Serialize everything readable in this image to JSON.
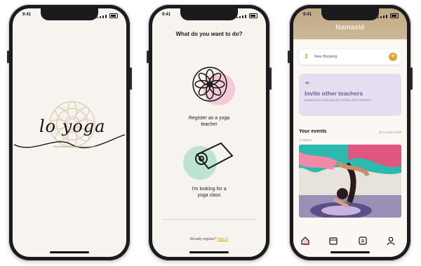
{
  "screens": [
    {
      "status_time": "9:41",
      "logo_text": "lo yoga"
    },
    {
      "status_time": "9:41",
      "question": "What do you want to do?",
      "option_teacher": [
        "Register as a yoga",
        "teacher"
      ],
      "option_class": [
        "I'm looking for a",
        "yoga class"
      ],
      "footer_text": "Already register?",
      "footer_link": "Sign in"
    },
    {
      "status_time": "9:41",
      "header_title": "Namasté",
      "booking": {
        "count": "3",
        "label": "New Booking",
        "plus": "+"
      },
      "invite": {
        "title": "Invite other teachers",
        "body": "Expand your earnings by inviting other teachers"
      },
      "events": {
        "title": "Your events",
        "date": "30 october 2019",
        "location": "© Athens"
      }
    }
  ],
  "colors": {
    "accent_orange": "#e2a432",
    "invite_bg": "#e6def0",
    "header_tan": "#c6b08e",
    "blob_pink": "#f4c9d8",
    "blob_green": "#bfe3d3"
  },
  "icons": {
    "nav": [
      "home-icon",
      "calendar-icon",
      "chat-icon",
      "profile-icon"
    ]
  }
}
